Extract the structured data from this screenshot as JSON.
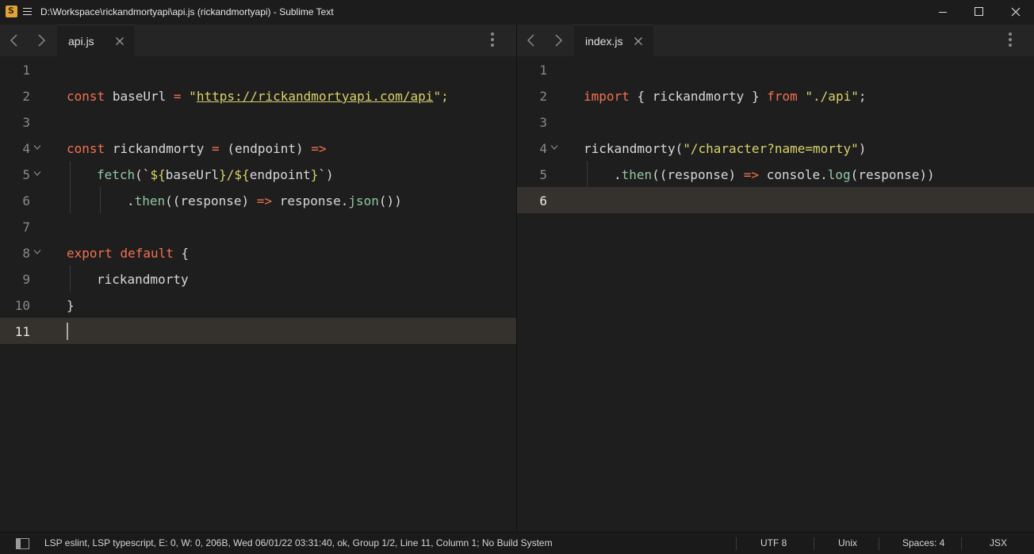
{
  "window": {
    "title": "D:\\Workspace\\rickandmortyapi\\api.js (rickandmortyapi) - Sublime Text"
  },
  "left_pane": {
    "tab_label": "api.js",
    "current_line": 11,
    "lines": [
      {
        "n": "1"
      },
      {
        "n": "2",
        "t": [
          "const",
          "baseUrl",
          "=",
          "\"",
          "https://rickandmortyapi.com/api",
          "\";"
        ]
      },
      {
        "n": "3"
      },
      {
        "n": "4",
        "t": [
          "const",
          "rickandmorty",
          "=",
          "(",
          "endpoint",
          ")",
          "=>"
        ]
      },
      {
        "n": "5",
        "t": [
          "fetch",
          "(`",
          "${",
          "baseUrl",
          "}",
          "/",
          "${",
          "endpoint",
          "}",
          "`)"
        ]
      },
      {
        "n": "6",
        "t": [
          ".",
          "then",
          "((",
          "response",
          ")",
          "=>",
          "response",
          ".",
          "json",
          "())"
        ]
      },
      {
        "n": "7"
      },
      {
        "n": "8",
        "t": [
          "export",
          "default",
          "{"
        ]
      },
      {
        "n": "9",
        "t": [
          "rickandmorty"
        ]
      },
      {
        "n": "10",
        "t": [
          "}"
        ]
      },
      {
        "n": "11"
      }
    ]
  },
  "right_pane": {
    "tab_label": "index.js",
    "current_line": 6,
    "lines": [
      {
        "n": "1"
      },
      {
        "n": "2",
        "t": [
          "import",
          "{",
          "rickandmorty",
          "}",
          "from",
          "\"./api\"",
          ";"
        ]
      },
      {
        "n": "3"
      },
      {
        "n": "4",
        "t": [
          "rickandmorty",
          "(",
          "\"/character?name=morty\"",
          ")"
        ]
      },
      {
        "n": "5",
        "t": [
          ".",
          "then",
          "((",
          "response",
          ")",
          "=>",
          "console",
          ".",
          "log",
          "(",
          "response",
          "))"
        ]
      },
      {
        "n": "6"
      }
    ]
  },
  "status_bar": {
    "info": "LSP eslint, LSP typescript, E: 0, W: 0, 206B, Wed 06/01/22 03:31:40, ok, Group 1/2, Line 11, Column 1; No Build System",
    "encoding": "UTF 8",
    "line_endings": "Unix",
    "indentation": "Spaces: 4",
    "syntax": "JSX"
  },
  "colors": {
    "keyword": "#f2714f",
    "function": "#93c7a0",
    "string": "#d9d26a",
    "background": "#1e1e1e",
    "current_line": "#35322d"
  },
  "icons": [
    "sublime-text-icon",
    "hamburger-menu-icon",
    "minimize-icon",
    "maximize-icon",
    "close-icon",
    "chevron-left-icon",
    "chevron-right-icon",
    "tab-close-icon",
    "kebab-menu-icon",
    "fold-chevron-icon",
    "side-panel-icon"
  ]
}
